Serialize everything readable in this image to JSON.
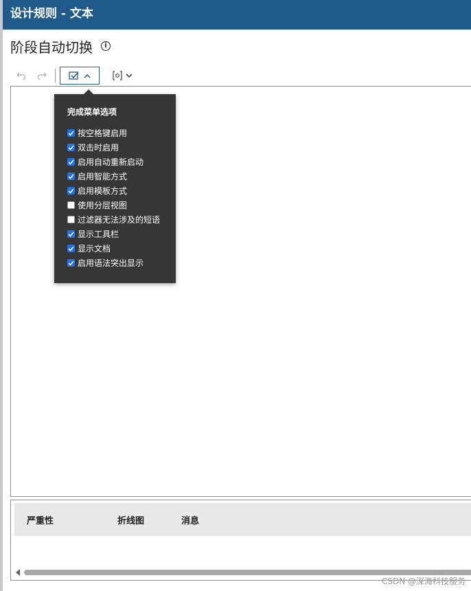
{
  "window": {
    "title": "设计规则 - 文本"
  },
  "header": {
    "title": "阶段自动切换",
    "info_icon": "info-icon"
  },
  "toolbar": {
    "undo_icon": "undo-icon",
    "redo_icon": "redo-icon",
    "completion_icon": "completion-check-icon",
    "param_icon": "parameter-icon"
  },
  "completion_menu": {
    "title": "完成菜单选项",
    "options": [
      {
        "label": "按空格键启用",
        "checked": true
      },
      {
        "label": "双击时启用",
        "checked": true
      },
      {
        "label": "启用自动重新启动",
        "checked": true
      },
      {
        "label": "启用智能方式",
        "checked": true
      },
      {
        "label": "启用模板方式",
        "checked": true
      },
      {
        "label": "使用分层视图",
        "checked": false
      },
      {
        "label": "过滤器无法涉及的短语",
        "checked": false
      },
      {
        "label": "显示工具栏",
        "checked": true
      },
      {
        "label": "显示文档",
        "checked": true
      },
      {
        "label": "启用语法突出显示",
        "checked": true
      }
    ]
  },
  "messages": {
    "columns": {
      "severity": "严重性",
      "diagram": "折线图",
      "message": "消息"
    }
  },
  "watermark": "CSDN @深海科技服务",
  "colors": {
    "titlebar": "#1f5a8a",
    "popup_bg": "#363636",
    "checkbox_on": "#1e73e8"
  }
}
